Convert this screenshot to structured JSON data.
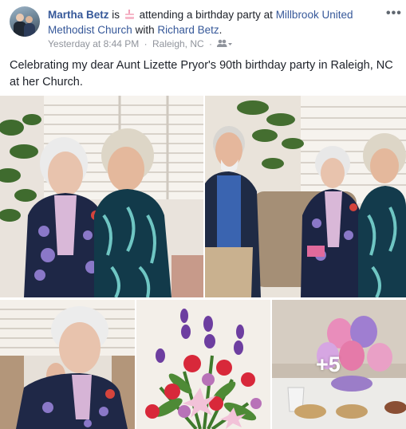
{
  "post": {
    "author": "Martha Betz",
    "is_text": "is",
    "activity_icon": "birthday-cake-icon",
    "activity_text": "attending a birthday party at",
    "place": "Millbrook United Methodist Church",
    "with_text": "with",
    "tagged_friend": "Richard Betz",
    "period": ".",
    "timestamp": "Yesterday at 8:44 PM",
    "separator": "·",
    "location": "Raleigh, NC",
    "audience_icon": "friends-audience-icon",
    "more_icon": "more-options-icon",
    "more_text": "•••",
    "message": "Celebrating my dear Aunt Lizette Pryor's 90th birthday party in Raleigh, NC at her Church."
  },
  "photos": {
    "extra_count_label": "+5"
  },
  "colors": {
    "link": "#365899",
    "meta": "#90949c",
    "text": "#1d2129"
  }
}
